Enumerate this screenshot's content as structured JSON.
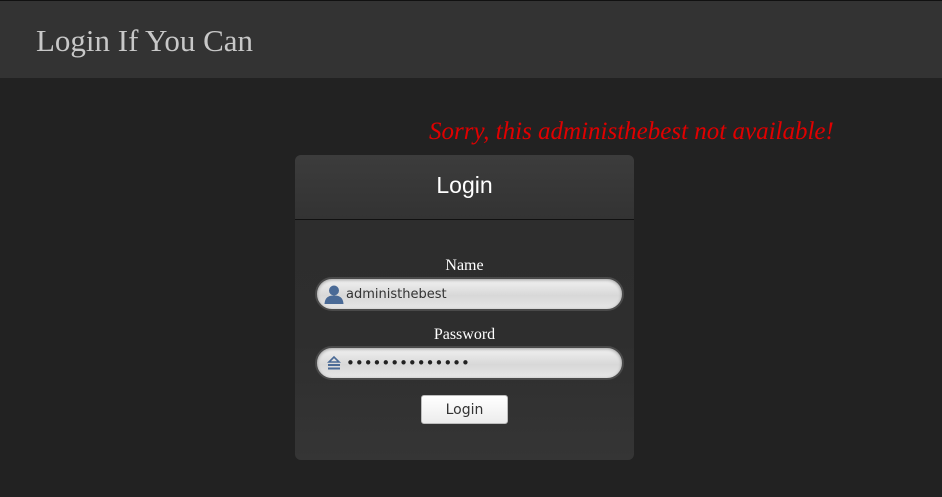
{
  "header": {
    "title": "Login If You Can"
  },
  "error": {
    "message": "Sorry, this administhebest not available!",
    "color": "#e00000"
  },
  "login_panel": {
    "title": "Login",
    "name_label": "Name",
    "name_value": "administhebest",
    "name_icon": "user-icon",
    "password_label": "Password",
    "password_value": "••••••••••••••",
    "password_icon": "lock-icon",
    "submit_label": "Login"
  }
}
